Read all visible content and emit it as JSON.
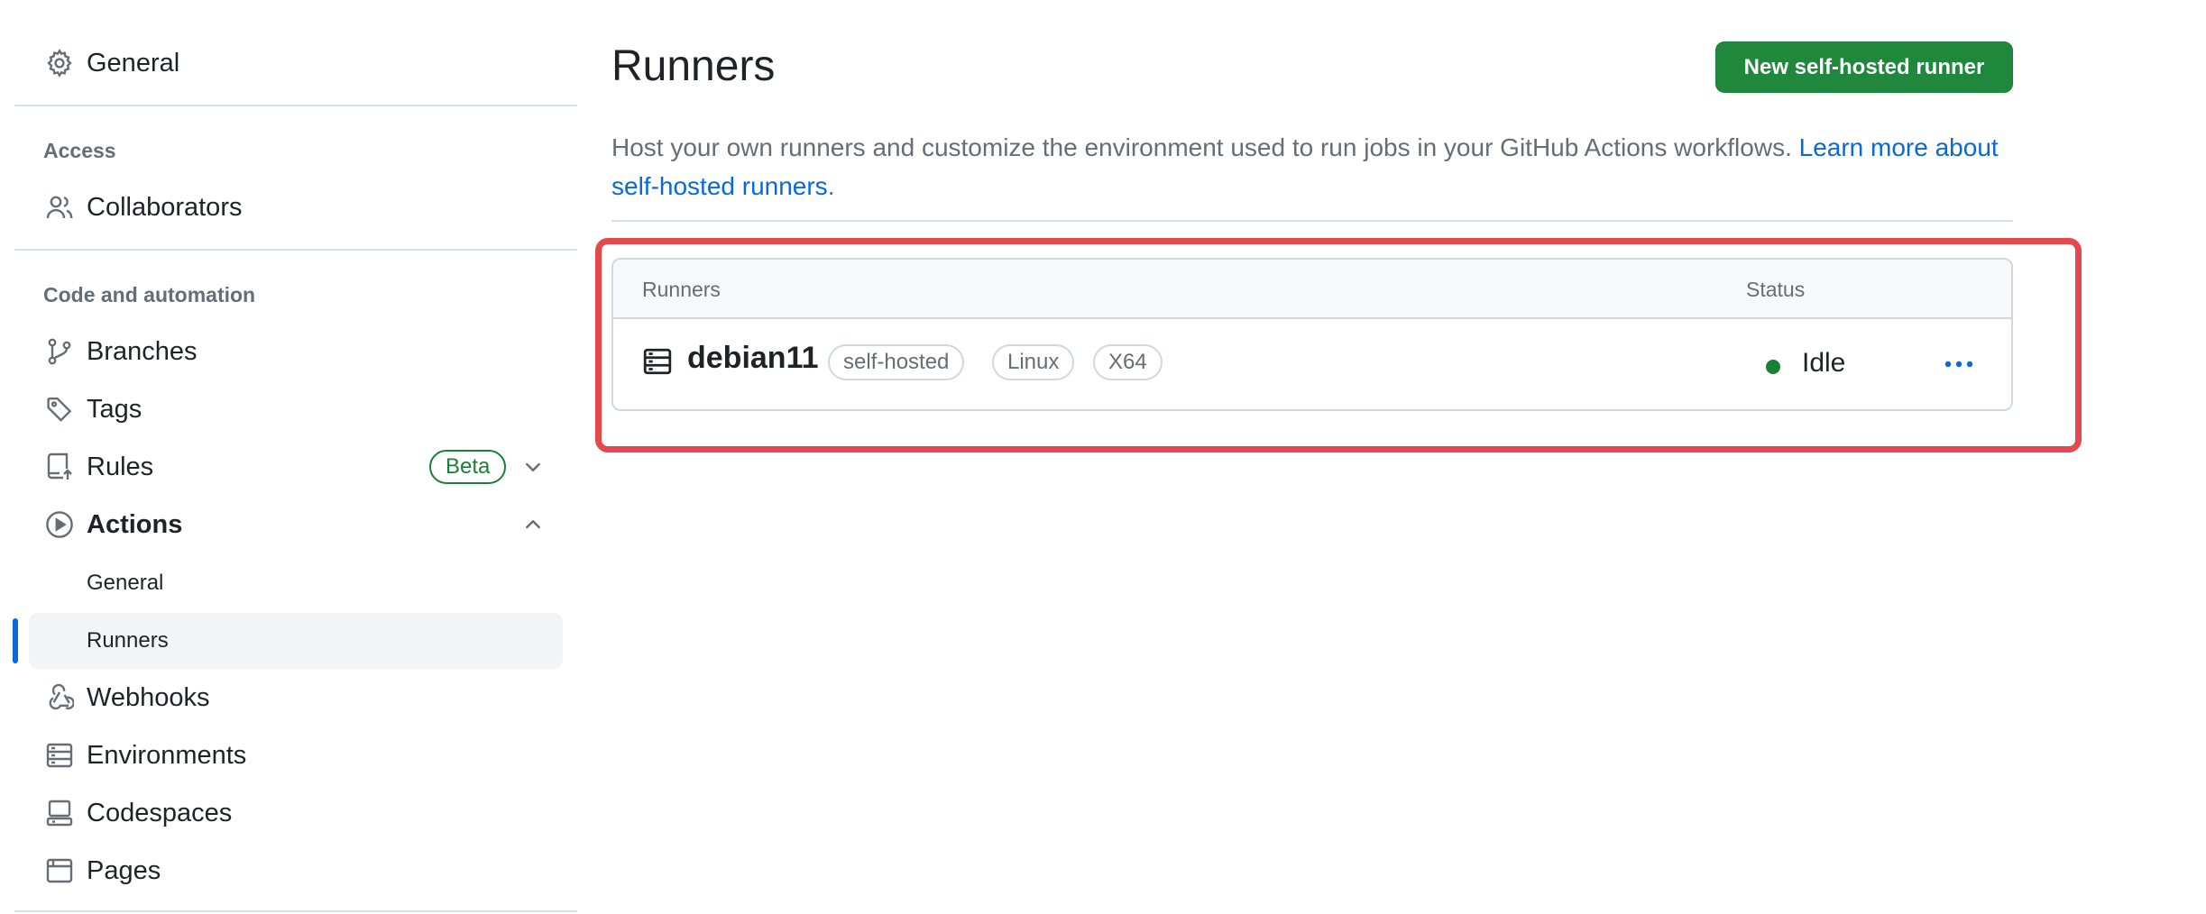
{
  "sidebar": {
    "general": "General",
    "access_heading": "Access",
    "collaborators": "Collaborators",
    "code_heading": "Code and automation",
    "branches": "Branches",
    "tags": "Tags",
    "rules": "Rules",
    "rules_badge": "Beta",
    "actions": "Actions",
    "actions_general": "General",
    "actions_runners": "Runners",
    "webhooks": "Webhooks",
    "environments": "Environments",
    "codespaces": "Codespaces",
    "pages": "Pages"
  },
  "main": {
    "title": "Runners",
    "new_runner_button": "New self-hosted runner",
    "description": "Host your own runners and customize the environment used to run jobs in your GitHub Actions workflows.",
    "learn_more_link": "Learn more about self-hosted runners",
    "description_end": "."
  },
  "table": {
    "columns": [
      "Runners",
      "Status"
    ],
    "rows": [
      {
        "name": "debian11",
        "labels": [
          "self-hosted",
          "Linux",
          "X64"
        ],
        "status": "Idle",
        "status_color": "#1a7f37",
        "icon": "server-icon"
      }
    ]
  },
  "colors": {
    "accent": "#0969da",
    "primary_button": "#1f883d",
    "highlight": "#e5484d",
    "beta": "#1a7f37"
  }
}
